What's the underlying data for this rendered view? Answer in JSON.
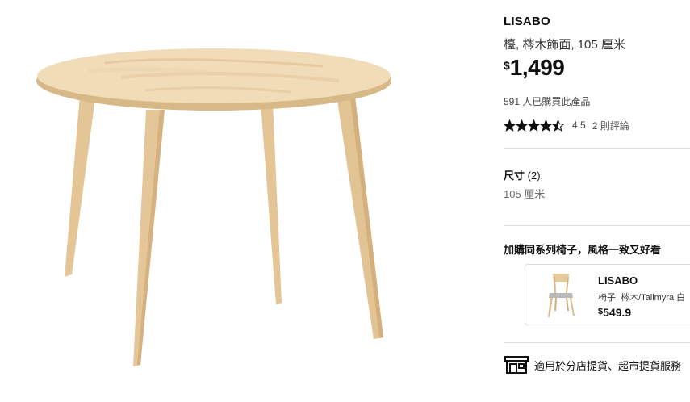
{
  "product": {
    "name": "LISABO",
    "description": "檯, 梣木飾面, 105 厘米",
    "price_currency": "$",
    "price_amount": "1,499",
    "sold_count": "591 人已購買此產品",
    "rating_value": "4.5",
    "rating_stars": 4.5,
    "rating_max": 5,
    "review_count": "2 則評論",
    "image_icon": "round-table-image"
  },
  "size": {
    "label": "尺寸",
    "count": "(2):",
    "value": "105 厘米"
  },
  "addon": {
    "heading": "加購同系列椅子，風格一致又好看",
    "item": {
      "name": "LISABO",
      "description": "椅子, 梣木/Tallmyra 白",
      "price_currency": "$",
      "price_amount": "549.9",
      "image_icon": "chair-image"
    }
  },
  "pickup": {
    "text": "適用於分店提貨、超市提貨服務",
    "icon": "store-pickup-icon"
  },
  "colors": {
    "wood": "#e7cba0",
    "star": "#111111",
    "divider": "#dfdfdf"
  }
}
